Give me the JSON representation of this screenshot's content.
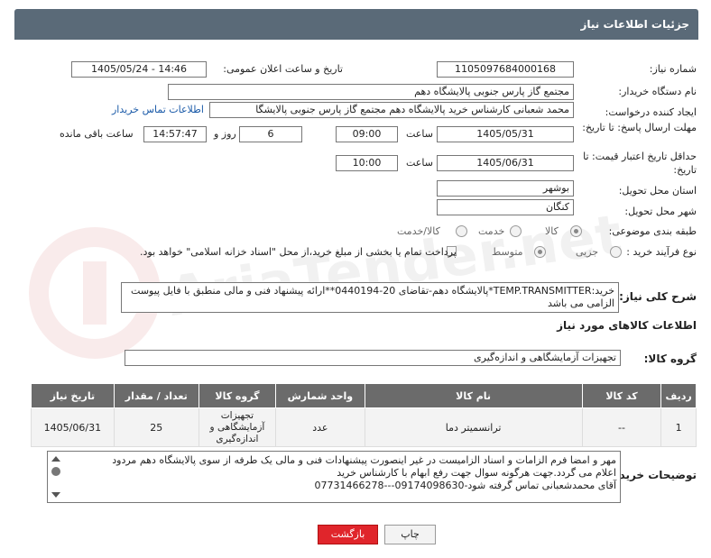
{
  "header": {
    "title": "جزئیات اطلاعات نیاز"
  },
  "fields": {
    "need_number_label": "شماره نیاز:",
    "need_number": "1105097684000168",
    "announce_label": "تاریخ و ساعت اعلان عمومی:",
    "announce_value": "1405/05/24 - 14:46",
    "buyer_org_label": "نام دستگاه خریدار:",
    "buyer_org": "مجتمع گاز پارس جنوبی  پالایشگاه دهم",
    "creator_label": "ایجاد کننده درخواست:",
    "creator": "محمد شعبانی کارشناس خرید پالایشگاه دهم  مجتمع گاز پارس جنوبی  پالایشگا",
    "contact_link": "اطلاعات تماس خریدار",
    "deadline_label": "مهلت ارسال پاسخ: تا تاریخ:",
    "deadline_date": "1405/05/31",
    "time_label": "ساعت",
    "deadline_time": "09:00",
    "days_value": "6",
    "days_label": "روز و",
    "remaining_time": "14:57:47",
    "remaining_label": "ساعت باقی مانده",
    "validity_label": "حداقل تاریخ اعتبار قیمت: تا تاریخ:",
    "validity_date": "1405/06/31",
    "validity_time": "10:00",
    "province_label": "استان محل تحویل:",
    "province": "بوشهر",
    "city_label": "شهر محل تحویل:",
    "city": "کنگان",
    "category_label": "طبقه بندی موضوعی:",
    "category_options": [
      "کالا",
      "خدمت",
      "کالا/خدمت"
    ],
    "process_label": "نوع فرآیند خرید :",
    "process_options": [
      "جزیی",
      "متوسط"
    ],
    "payment_note": "پرداخت تمام یا بخشی از مبلغ خرید،از محل \"اسناد خزانه اسلامی\" خواهد بود."
  },
  "description": {
    "label": "شرح کلی نیاز:",
    "text": "خرید:TEMP.TRANSMITTER*پالایشگاه دهم-تقاضای 20-0440194**ارائه پیشنهاد فنی و مالی منطبق با فایل پیوست الزامی می باشد"
  },
  "goods_info_title": "اطلاعات کالاهای مورد نیاز",
  "goods_group": {
    "label": "گروه کالا:",
    "value": "تجهیزات آزمایشگاهی و اندازه‌گیری"
  },
  "table": {
    "headers": [
      "ردیف",
      "کد کالا",
      "نام کالا",
      "واحد شمارش",
      "گروه کالا",
      "تعداد / مقدار",
      "تاریخ نیاز"
    ],
    "rows": [
      [
        "1",
        "--",
        "ترانسمیتر دما",
        "عدد",
        "تجهیزات آزمایشگاهی و اندازه‌گیری",
        "25",
        "1405/06/31"
      ]
    ]
  },
  "buyer_notes": {
    "label": "توضیحات خریدار:",
    "line1": "مهر و امضا فرم الزامات و اسناد الزامیست در غیر اینصورت پیشنهادات فنی و مالی یک طرفه از سوی پالایشگاه دهم مردود",
    "line2": "اعلام می گردد.جهت هرگونه سوال جهت رفع ابهام با کارشناس خرید",
    "line3": "آقای محمدشعبانی تماس گرفته شود-09174098630---07731466278"
  },
  "buttons": {
    "print": "چاپ",
    "back": "بازگشت"
  },
  "watermark": "AriaTender.net"
}
